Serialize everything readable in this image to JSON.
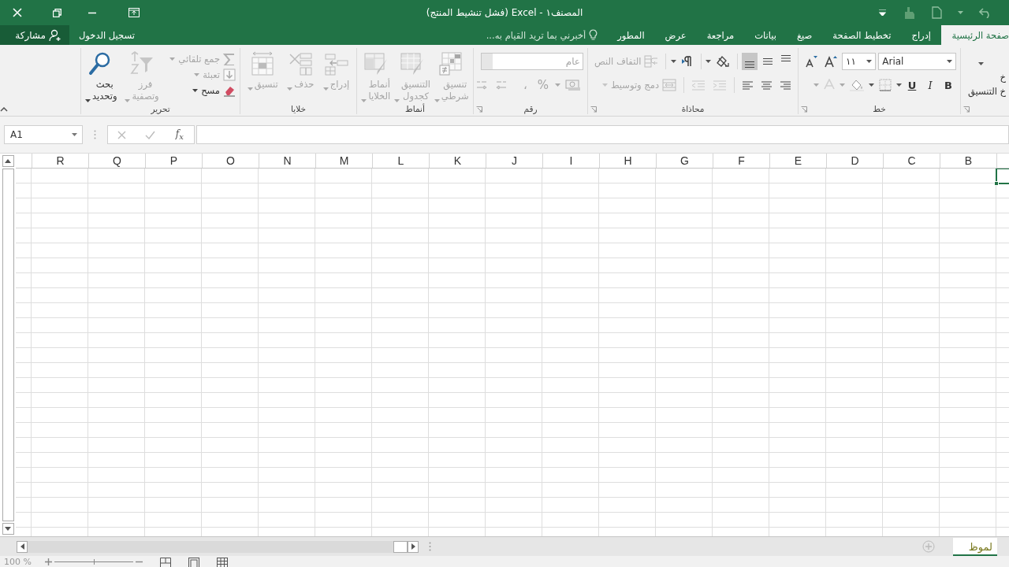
{
  "window": {
    "title": "المصنف١ - Excel (فشل تنشيط المنتج)"
  },
  "ribbon_tabs": [
    {
      "label": "صفحة الرئيسية",
      "selected": true
    },
    {
      "label": "إدراج",
      "selected": false
    },
    {
      "label": "تخطيط الصفحة",
      "selected": false
    },
    {
      "label": "صيغ",
      "selected": false
    },
    {
      "label": "بيانات",
      "selected": false
    },
    {
      "label": "مراجعة",
      "selected": false
    },
    {
      "label": "عرض",
      "selected": false
    },
    {
      "label": "المطور",
      "selected": false
    }
  ],
  "tell_me": {
    "placeholder": "أخبرني بما تريد القيام به..."
  },
  "account": {
    "sign_in": "تسجيل الدخول",
    "share": "مشاركة"
  },
  "ribbon_groups": [
    {
      "kind": "clipboard",
      "items": [
        {
          "label": "خ"
        },
        {
          "label": "خ التنسيق"
        }
      ]
    },
    {
      "kind": "font",
      "label": "خط",
      "font_name": "Arial",
      "font_size": "١١",
      "styles": [
        "B",
        "I",
        "U"
      ]
    },
    {
      "kind": "alignment",
      "label": "محاذاة",
      "vertical_align": [
        {
          "selected": false
        },
        {
          "selected": false
        },
        {
          "selected": true
        }
      ],
      "wrap_text": {
        "label": "التفاف النص",
        "disabled": true
      },
      "merge": {
        "label": "دمج وتوسيط",
        "disabled": true
      }
    },
    {
      "kind": "number",
      "label": "رقم",
      "format": "عام",
      "percent": "%",
      "comma": "،",
      "disabled": true
    },
    {
      "kind": "styles",
      "label": "أنماط",
      "buttons": [
        {
          "label": "تنسيق شرطي",
          "disabled": true
        },
        {
          "label": "التنسيق كجدول",
          "disabled": true
        },
        {
          "label": "أنماط الخلايا",
          "disabled": true
        }
      ]
    },
    {
      "kind": "cells",
      "label": "خلايا",
      "buttons": [
        {
          "label": "إدراج",
          "disabled": true
        },
        {
          "label": "حذف",
          "disabled": true
        },
        {
          "label": "تنسيق",
          "disabled": true
        }
      ]
    },
    {
      "kind": "editing",
      "label": "تحرير",
      "small": [
        {
          "label": "جمع تلقائي",
          "disabled": true
        },
        {
          "label": "تعبئة",
          "disabled": true
        },
        {
          "label": "مسح",
          "disabled": false
        }
      ],
      "buttons": [
        {
          "label": "فرز وتصفية",
          "disabled": true
        },
        {
          "label": "بحث وتحديد",
          "disabled": false
        }
      ]
    }
  ],
  "formula_bar": {
    "name_box": "A1",
    "function_label": "f$_{x}$"
  },
  "columns": [
    "B",
    "C",
    "D",
    "E",
    "F",
    "G",
    "H",
    "I",
    "J",
    "K",
    "L",
    "M",
    "N",
    "O",
    "P",
    "Q",
    "R"
  ],
  "sheet_tabs": [
    {
      "label": "لموظ",
      "selected": true
    }
  ],
  "status_bar": {
    "zoom": "100 %",
    "zoom_slider": {
      "level": 0.5
    }
  }
}
